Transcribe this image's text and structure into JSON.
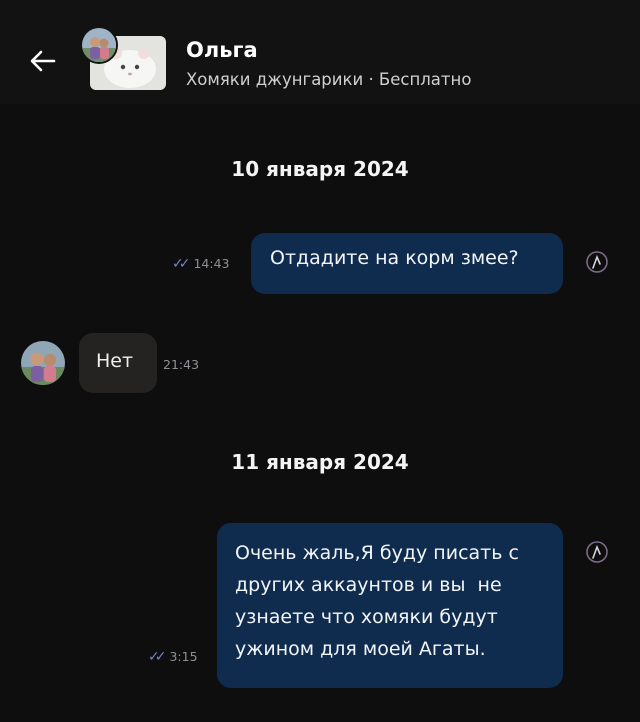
{
  "header": {
    "seller_name": "Ольга",
    "listing": "Хомяки джунгарики · Бесплатно"
  },
  "chat": {
    "date1": "10 января 2024",
    "date2": "11 января 2024",
    "messages": [
      {
        "direction": "outgoing",
        "text": "Отдадите на корм змее?",
        "time": "14:43",
        "status": "read"
      },
      {
        "direction": "incoming",
        "text": "Нет",
        "time": "21:43"
      },
      {
        "direction": "outgoing",
        "lines": [
          "Очень жаль,Я буду писать с",
          "других аккаунтов и вы  не",
          "узнаете что хомяки будут",
          "ужином для моей Агаты."
        ],
        "time": "3:15",
        "status": "read"
      }
    ]
  },
  "colors": {
    "background": "#0e0e0f",
    "outgoing_bubble": "#0f2c4f",
    "incoming_bubble": "#242321",
    "read_ticks": "#6c86c8"
  },
  "icons": [
    "arrow-left-icon",
    "double-check-icon",
    "reaction-icon"
  ]
}
